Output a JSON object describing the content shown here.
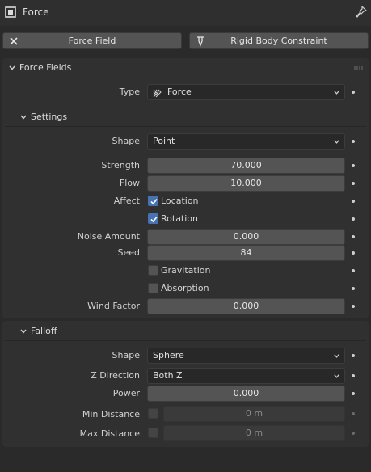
{
  "header": {
    "title": "Force"
  },
  "top_buttons": [
    {
      "label": "Force Field"
    },
    {
      "label": "Rigid Body Constraint"
    }
  ],
  "force_fields": {
    "title": "Force Fields",
    "type": {
      "label": "Type",
      "value": "Force"
    },
    "settings": {
      "title": "Settings",
      "shape": {
        "label": "Shape",
        "value": "Point"
      },
      "strength": {
        "label": "Strength",
        "value": "70.000"
      },
      "flow": {
        "label": "Flow",
        "value": "10.000"
      },
      "affect": {
        "label": "Affect",
        "location": {
          "label": "Location",
          "checked": true
        },
        "rotation": {
          "label": "Rotation",
          "checked": true
        }
      },
      "noise_amount": {
        "label": "Noise Amount",
        "value": "0.000"
      },
      "seed": {
        "label": "Seed",
        "value": "84"
      },
      "gravitation": {
        "label": "Gravitation",
        "checked": false
      },
      "absorption": {
        "label": "Absorption",
        "checked": false
      },
      "wind_factor": {
        "label": "Wind Factor",
        "value": "0.000"
      }
    }
  },
  "falloff": {
    "title": "Falloff",
    "shape": {
      "label": "Shape",
      "value": "Sphere"
    },
    "z_direction": {
      "label": "Z Direction",
      "value": "Both Z"
    },
    "power": {
      "label": "Power",
      "value": "0.000"
    },
    "min_distance": {
      "label": "Min Distance",
      "value": "0 m",
      "enabled": false
    },
    "max_distance": {
      "label": "Max Distance",
      "value": "0 m",
      "enabled": false
    }
  },
  "colors": {
    "background": "#2a2a2a",
    "panel": "#303030",
    "field": "#545454",
    "checkbox_checked": "#4772b3"
  }
}
